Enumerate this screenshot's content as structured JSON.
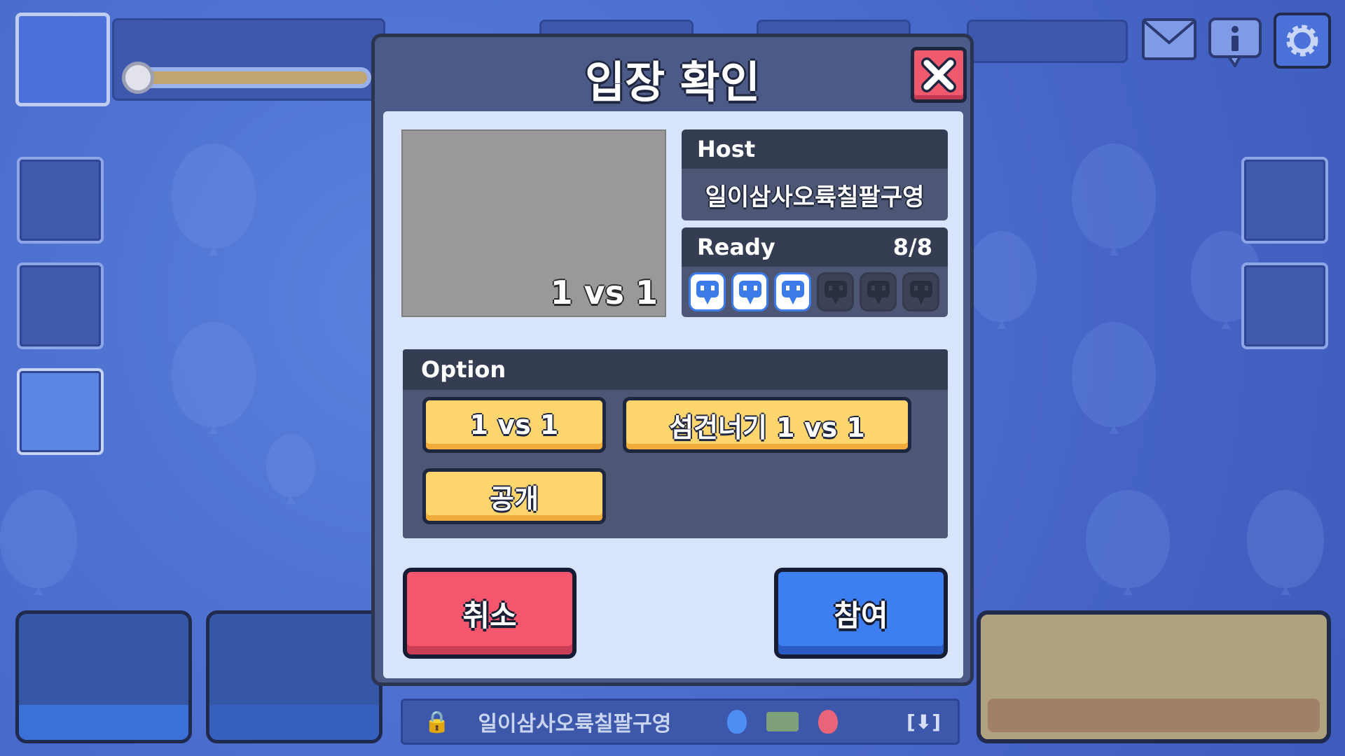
{
  "background": {
    "room_row": {
      "room_name": "일이삼사오륙칠팔구영",
      "download_label": "[⬇]"
    }
  },
  "dialog": {
    "title": "입장 확인",
    "map": {
      "mode_label": "1 vs 1"
    },
    "host": {
      "header": "Host",
      "name": "일이삼사오륙칠팔구영"
    },
    "ready": {
      "header": "Ready",
      "count": "8/8",
      "slots": [
        "filled",
        "filled",
        "filled",
        "empty",
        "empty",
        "empty"
      ]
    },
    "option": {
      "header": "Option",
      "buttons": [
        "1 vs 1",
        "섬건너기 1 vs 1",
        "공개"
      ]
    },
    "cancel_label": "취소",
    "join_label": "참여"
  },
  "colors": {
    "cancel": "#f4566e",
    "join": "#3d7ef0",
    "option": "#ffd66e",
    "close": "#f05a6e"
  },
  "icons": [
    "close-icon",
    "mail-icon",
    "info-icon",
    "gear-icon",
    "lock-icon",
    "player-icon"
  ]
}
